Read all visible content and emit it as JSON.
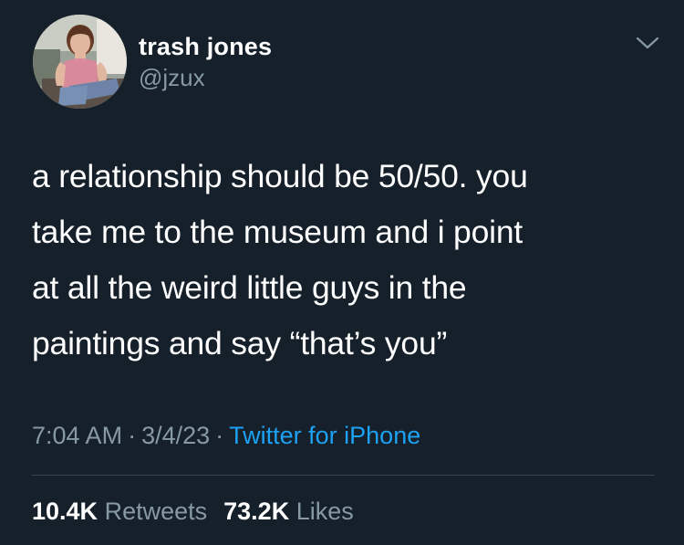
{
  "author": {
    "display_name": "trash jones",
    "handle": "@jzux"
  },
  "tweet": {
    "lines": [
      "a relationship should be 50/50. you",
      "take me to the museum and i point",
      "at all the weird little guys in the",
      "paintings and say “that’s you”"
    ],
    "time": "7:04 AM",
    "separator": "·",
    "date": "3/4/23",
    "source": "Twitter for iPhone"
  },
  "stats": {
    "retweets_count": "10.4K",
    "retweets_label": "Retweets",
    "likes_count": "73.2K",
    "likes_label": "Likes"
  },
  "icons": {
    "menu": "chevron-down-icon"
  },
  "colors": {
    "background": "#15202b",
    "text": "#ffffff",
    "secondary_text": "#8899a6",
    "link": "#1da1f2",
    "divider": "#38444d"
  }
}
